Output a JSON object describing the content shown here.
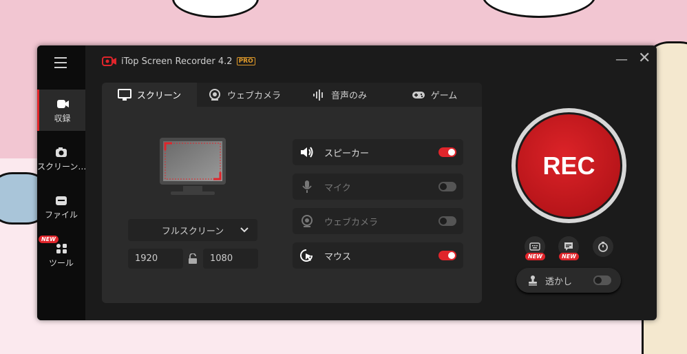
{
  "app": {
    "title": "iTop Screen Recorder 4.2",
    "pro_badge": "PRO",
    "accent_color": "#e0252b"
  },
  "sidebar": {
    "menu_icon": "hamburger-icon",
    "items": [
      {
        "label": "収録",
        "icon": "record-camera-icon"
      },
      {
        "label": "スクリーン…",
        "icon": "screenshot-camera-icon"
      },
      {
        "label": "ファイル",
        "icon": "folder-icon"
      },
      {
        "label": "ツール",
        "icon": "tools-grid-icon",
        "badge": "NEW"
      }
    ]
  },
  "tabs": [
    {
      "label": "スクリーン",
      "icon": "monitor-icon"
    },
    {
      "label": "ウェブカメラ",
      "icon": "webcam-icon"
    },
    {
      "label": "音声のみ",
      "icon": "audio-wave-icon"
    },
    {
      "label": "ゲーム",
      "icon": "gamepad-icon"
    }
  ],
  "screen": {
    "mode": "フルスクリーン",
    "width": "1920",
    "height": "1080"
  },
  "options": [
    {
      "label": "スピーカー",
      "icon": "speaker-icon",
      "on": true
    },
    {
      "label": "マイク",
      "icon": "microphone-icon",
      "on": false
    },
    {
      "label": "ウェブカメラ",
      "icon": "webcam-icon",
      "on": false
    },
    {
      "label": "マウス",
      "icon": "mouse-cursor-icon",
      "on": true
    }
  ],
  "rec": {
    "label": "REC",
    "tools": [
      {
        "icon": "keyboard-icon",
        "badge": "NEW"
      },
      {
        "icon": "subtitle-icon",
        "badge": "NEW"
      },
      {
        "icon": "timer-icon"
      }
    ],
    "watermark_label": "透かし",
    "watermark_on": false
  }
}
